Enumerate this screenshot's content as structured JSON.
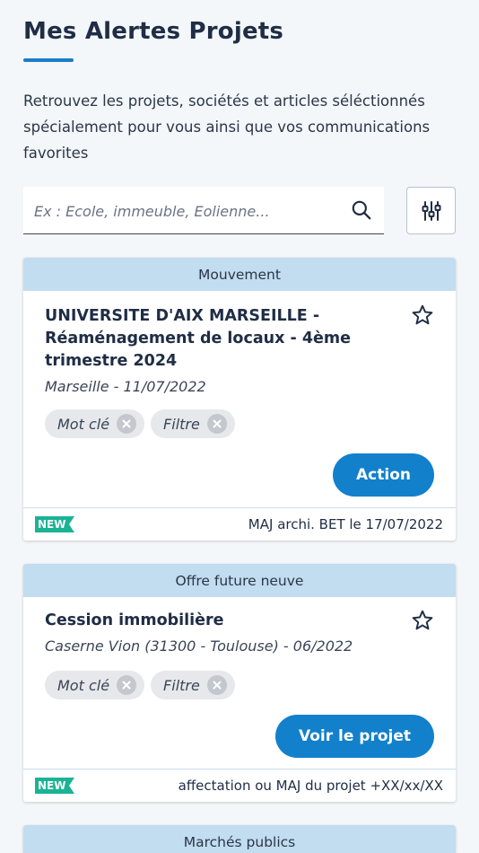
{
  "page": {
    "title": "Mes Alertes Projets",
    "intro": "Retrouvez les projets, sociétés et articles séléctionnés spécialement pour vous ainsi que vos communications favorites"
  },
  "search": {
    "placeholder": "Ex : Ecole, immeuble, Eolienne...",
    "search_icon": "search-icon",
    "filter_icon": "sliders-icon"
  },
  "colors": {
    "accent": "#1380cc",
    "header_bg": "#c2dcf0",
    "new_badge": "#1ab394",
    "title_text": "#1f2d45"
  },
  "cards": [
    {
      "category": "Mouvement",
      "title": "UNIVERSITE D'AIX MARSEILLE - Réaménagement de locaux - 4ème trimestre 2024",
      "meta": "Marseille - 11/07/2022",
      "tags": [
        "Mot clé",
        "Filtre"
      ],
      "action_label": "Action",
      "badge": "NEW",
      "footer": "MAJ archi. BET le 17/07/2022"
    },
    {
      "category": "Offre future neuve",
      "title": "Cession immobilière",
      "meta": "Caserne Vion (31300 - Toulouse) - 06/2022",
      "tags": [
        "Mot clé",
        "Filtre"
      ],
      "action_label": "Voir le projet",
      "badge": "NEW",
      "footer": "affectation ou MAJ du projet +XX/xx/XX"
    },
    {
      "category": "Marchés publics"
    }
  ]
}
